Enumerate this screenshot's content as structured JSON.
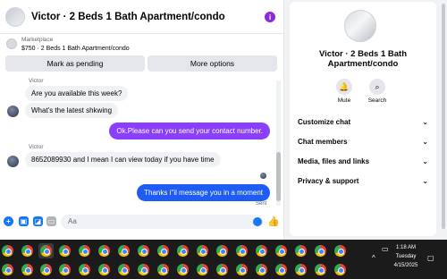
{
  "chat": {
    "title": "Victor · 2 Beds 1 Bath Apartment/condo",
    "marketplace_label": "Marketplace",
    "listing_summary": "$750 · 2 Beds 1 Bath Apartment/condo",
    "mark_pending_label": "Mark as pending",
    "more_options_label": "More options",
    "messages": [
      {
        "sender": "Victor",
        "text": "Are you available this week?"
      },
      {
        "text": "What's the latest shkwing"
      },
      {
        "text": "Ok.Please can you send your contact number."
      },
      {
        "sender": "Victor",
        "text": "8652089930 and I mean I can view today if you have time"
      },
      {
        "text": "Thanks i''il message you in a moment"
      }
    ],
    "sent_label": "Sent",
    "composer_placeholder": "Aa",
    "info_icon": "i"
  },
  "profile": {
    "name_line1": "Victor · 2 Beds 1 Bath",
    "name_line2": "Apartment/condo",
    "mute_label": "Mute",
    "search_label": "Search",
    "rows": [
      "Customize chat",
      "Chat members",
      "Media, files and links",
      "Privacy & support"
    ]
  },
  "taskbar": {
    "time": "1:18 AM",
    "day": "Tuesday",
    "date": "4/15/2025"
  },
  "colors": {
    "messenger_blue": "#1e5cf4",
    "purple_bubble": "#8a3ffc",
    "info_purple": "#8a2be2"
  }
}
